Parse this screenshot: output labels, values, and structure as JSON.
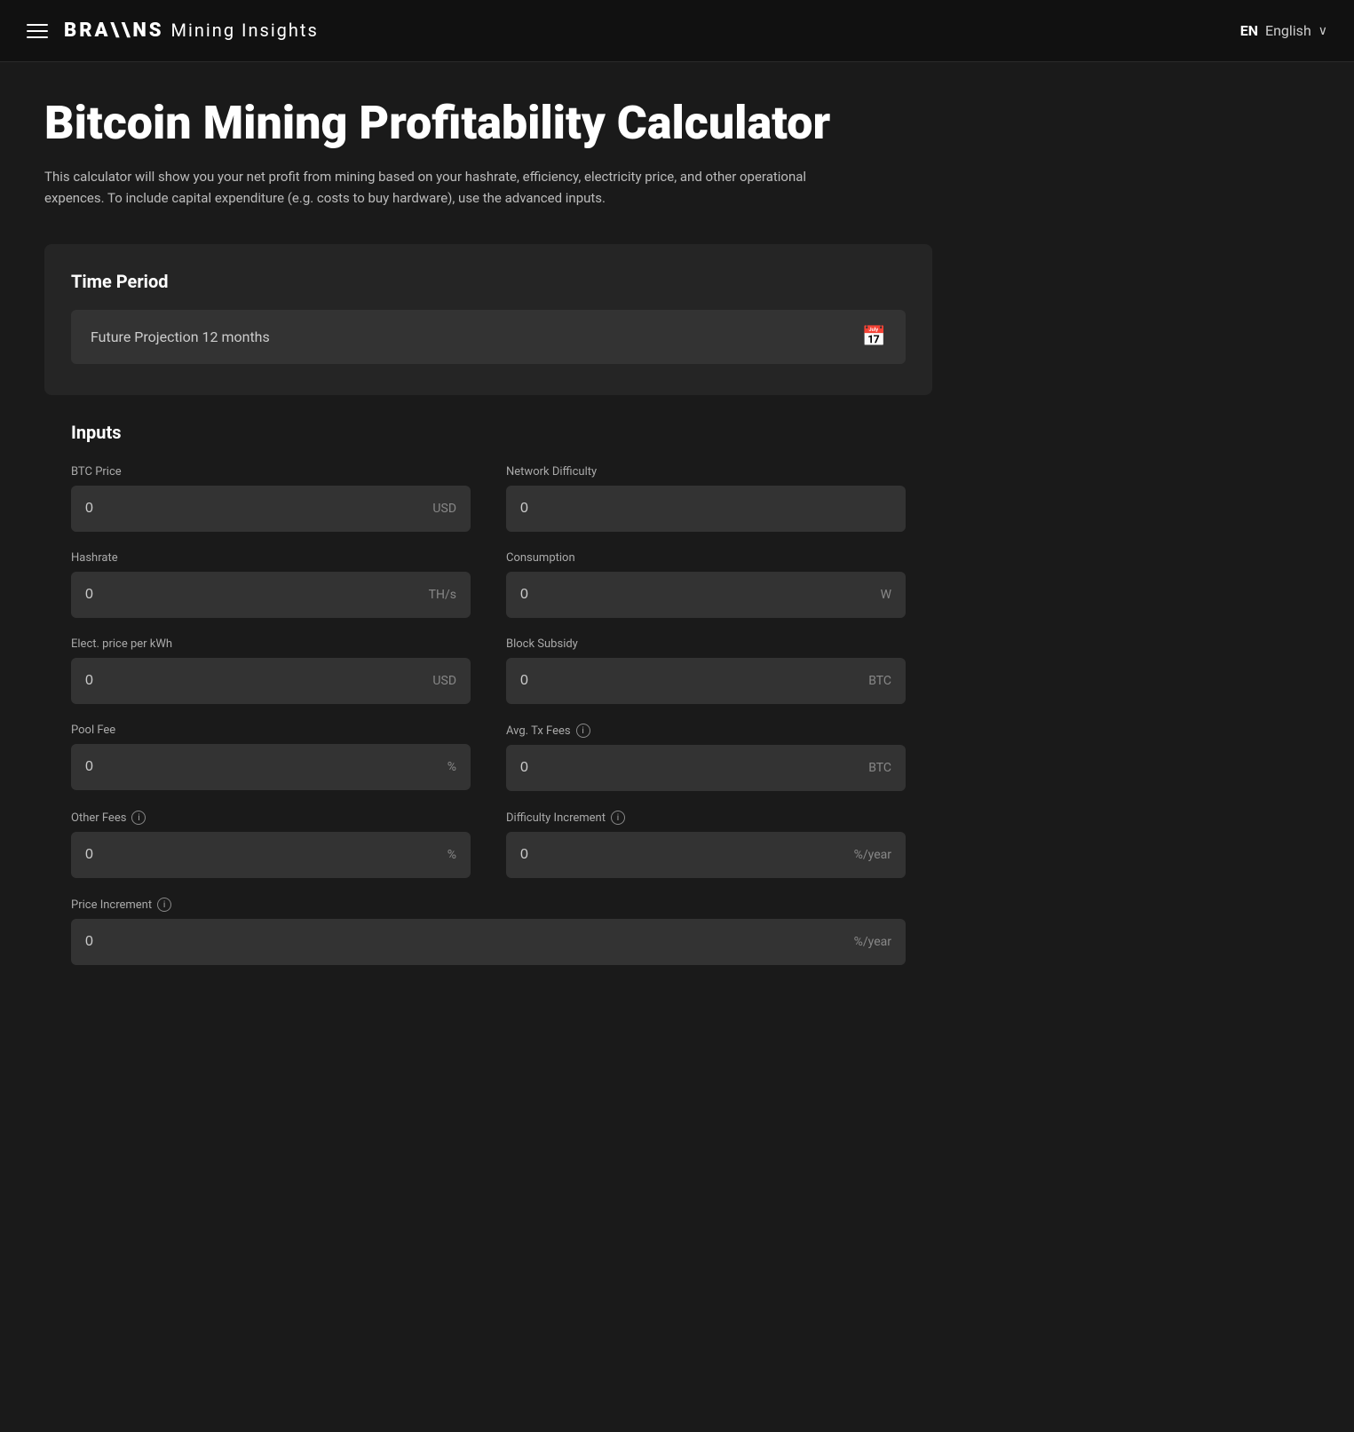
{
  "navbar": {
    "logo_brand": "BRA\\\\NS",
    "logo_sub": "Mining Insights",
    "lang_code": "EN",
    "lang_name": "English",
    "chevron": "∨"
  },
  "page": {
    "title": "Bitcoin Mining Profitability Calculator",
    "description": "This calculator will show you your net profit from mining based on your hashrate, efficiency, electricity price, and other operational expences. To include capital expenditure (e.g. costs to buy hardware), use the advanced inputs."
  },
  "time_period": {
    "section_title": "Time Period",
    "selected_label": "Future Projection 12 months"
  },
  "inputs": {
    "section_title": "Inputs",
    "fields": [
      {
        "id": "btc-price",
        "label": "BTC Price",
        "value": "0",
        "unit": "USD",
        "info": false,
        "col": "left"
      },
      {
        "id": "network-difficulty",
        "label": "Network Difficulty",
        "value": "0",
        "unit": "",
        "info": false,
        "col": "right"
      },
      {
        "id": "hashrate",
        "label": "Hashrate",
        "value": "0",
        "unit": "TH/s",
        "info": false,
        "col": "left"
      },
      {
        "id": "consumption",
        "label": "Consumption",
        "value": "0",
        "unit": "W",
        "info": false,
        "col": "right"
      },
      {
        "id": "elect-price",
        "label": "Elect. price per kWh",
        "value": "0",
        "unit": "USD",
        "info": false,
        "col": "left"
      },
      {
        "id": "block-subsidy",
        "label": "Block Subsidy",
        "value": "0",
        "unit": "BTC",
        "info": false,
        "col": "right"
      },
      {
        "id": "pool-fee",
        "label": "Pool Fee",
        "value": "0",
        "unit": "%",
        "info": false,
        "col": "left"
      },
      {
        "id": "avg-tx-fees",
        "label": "Avg. Tx Fees",
        "value": "0",
        "unit": "BTC",
        "info": true,
        "col": "right"
      },
      {
        "id": "other-fees",
        "label": "Other Fees",
        "value": "0",
        "unit": "%",
        "info": true,
        "col": "left"
      },
      {
        "id": "difficulty-increment",
        "label": "Difficulty Increment",
        "value": "0",
        "unit": "%/year",
        "info": true,
        "col": "right"
      }
    ],
    "full_width_fields": [
      {
        "id": "price-increment",
        "label": "Price Increment",
        "value": "0",
        "unit": "%/year",
        "info": true
      }
    ]
  }
}
